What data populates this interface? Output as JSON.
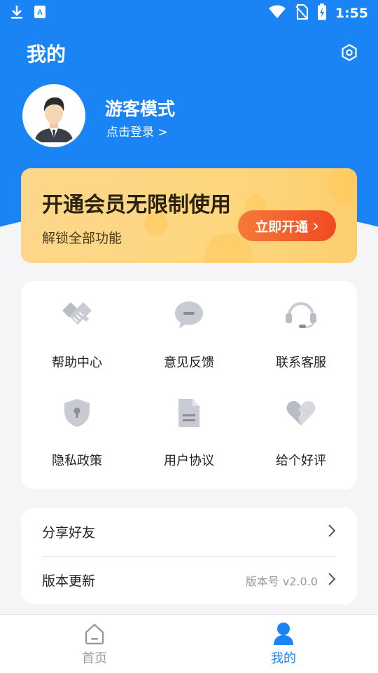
{
  "status_bar": {
    "time": "1:55",
    "icons": [
      "download-icon",
      "keyboard-icon",
      "wifi-icon",
      "no-sim-icon",
      "battery-charging-icon"
    ]
  },
  "header": {
    "title": "我的",
    "settings_icon": "settings-icon"
  },
  "profile": {
    "name": "游客模式",
    "login_text": "点击登录 >"
  },
  "vip": {
    "title": "开通会员无限制使用",
    "subtitle": "解锁全部功能",
    "button_label": "立即开通",
    "button_chevron": "›"
  },
  "grid": {
    "items": [
      {
        "label": "帮助中心",
        "icon": "handshake-icon"
      },
      {
        "label": "意见反馈",
        "icon": "chat-bubble-icon"
      },
      {
        "label": "联系客服",
        "icon": "headset-icon"
      },
      {
        "label": "隐私政策",
        "icon": "shield-icon"
      },
      {
        "label": "用户协议",
        "icon": "document-icon"
      },
      {
        "label": "给个好评",
        "icon": "heart-icon"
      }
    ]
  },
  "list": {
    "share_label": "分享好友",
    "update_label": "版本更新",
    "version_text": "版本号 v2.0.0"
  },
  "tabbar": {
    "home_label": "首页",
    "mine_label": "我的"
  },
  "colors": {
    "primary": "#1a84f5",
    "vip_bg": "#fdd67e",
    "vip_button": "#f04a22",
    "icon_gray": "#b9bcc4",
    "tab_inactive": "#9a9a9a"
  }
}
